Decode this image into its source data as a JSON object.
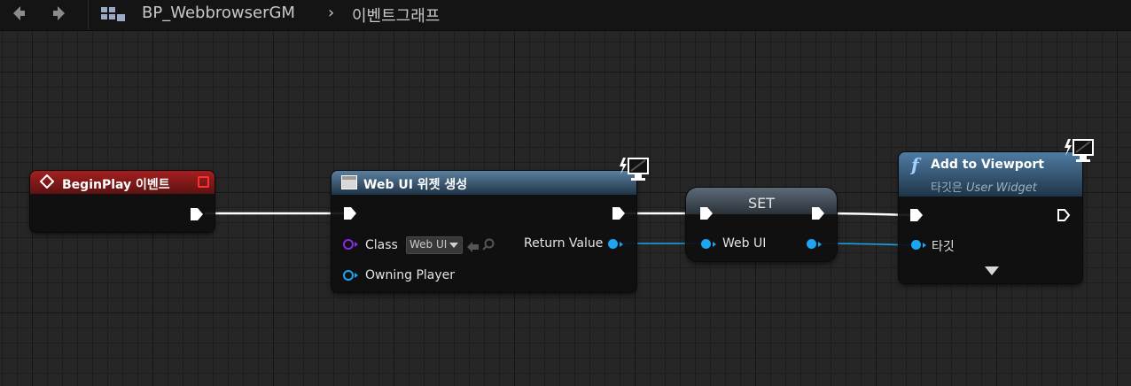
{
  "breadcrumb": {
    "blueprint": "BP_WebbrowserGM",
    "graph": "이벤트그래프"
  },
  "nodes": {
    "begin_play": {
      "title": "BeginPlay 이벤트"
    },
    "create_widget": {
      "title": "Web UI 위젯 생성",
      "class_label": "Class",
      "class_value": "Web UI",
      "owning_player_label": "Owning Player",
      "return_value_label": "Return Value"
    },
    "set": {
      "title": "SET",
      "var_label": "Web UI"
    },
    "add_to_viewport": {
      "title": "Add to Viewport",
      "subtitle_prefix": "타깃은",
      "subtitle_target": "User Widget",
      "target_label": "타깃"
    }
  },
  "colors": {
    "event_header": "#8b1a1a",
    "function_header": "#3a6a8f",
    "object_pin": "#1aa6f0",
    "class_pin": "#8a2be2",
    "exec_wire": "#ffffff"
  },
  "icons": [
    "back-arrow-icon",
    "forward-arrow-icon",
    "blueprint-icon",
    "event-diamond-icon",
    "delegate-square-icon",
    "widget-icon",
    "function-icon",
    "monitor-icon",
    "dropdown-arrow-icon",
    "advanced-expand-icon"
  ]
}
